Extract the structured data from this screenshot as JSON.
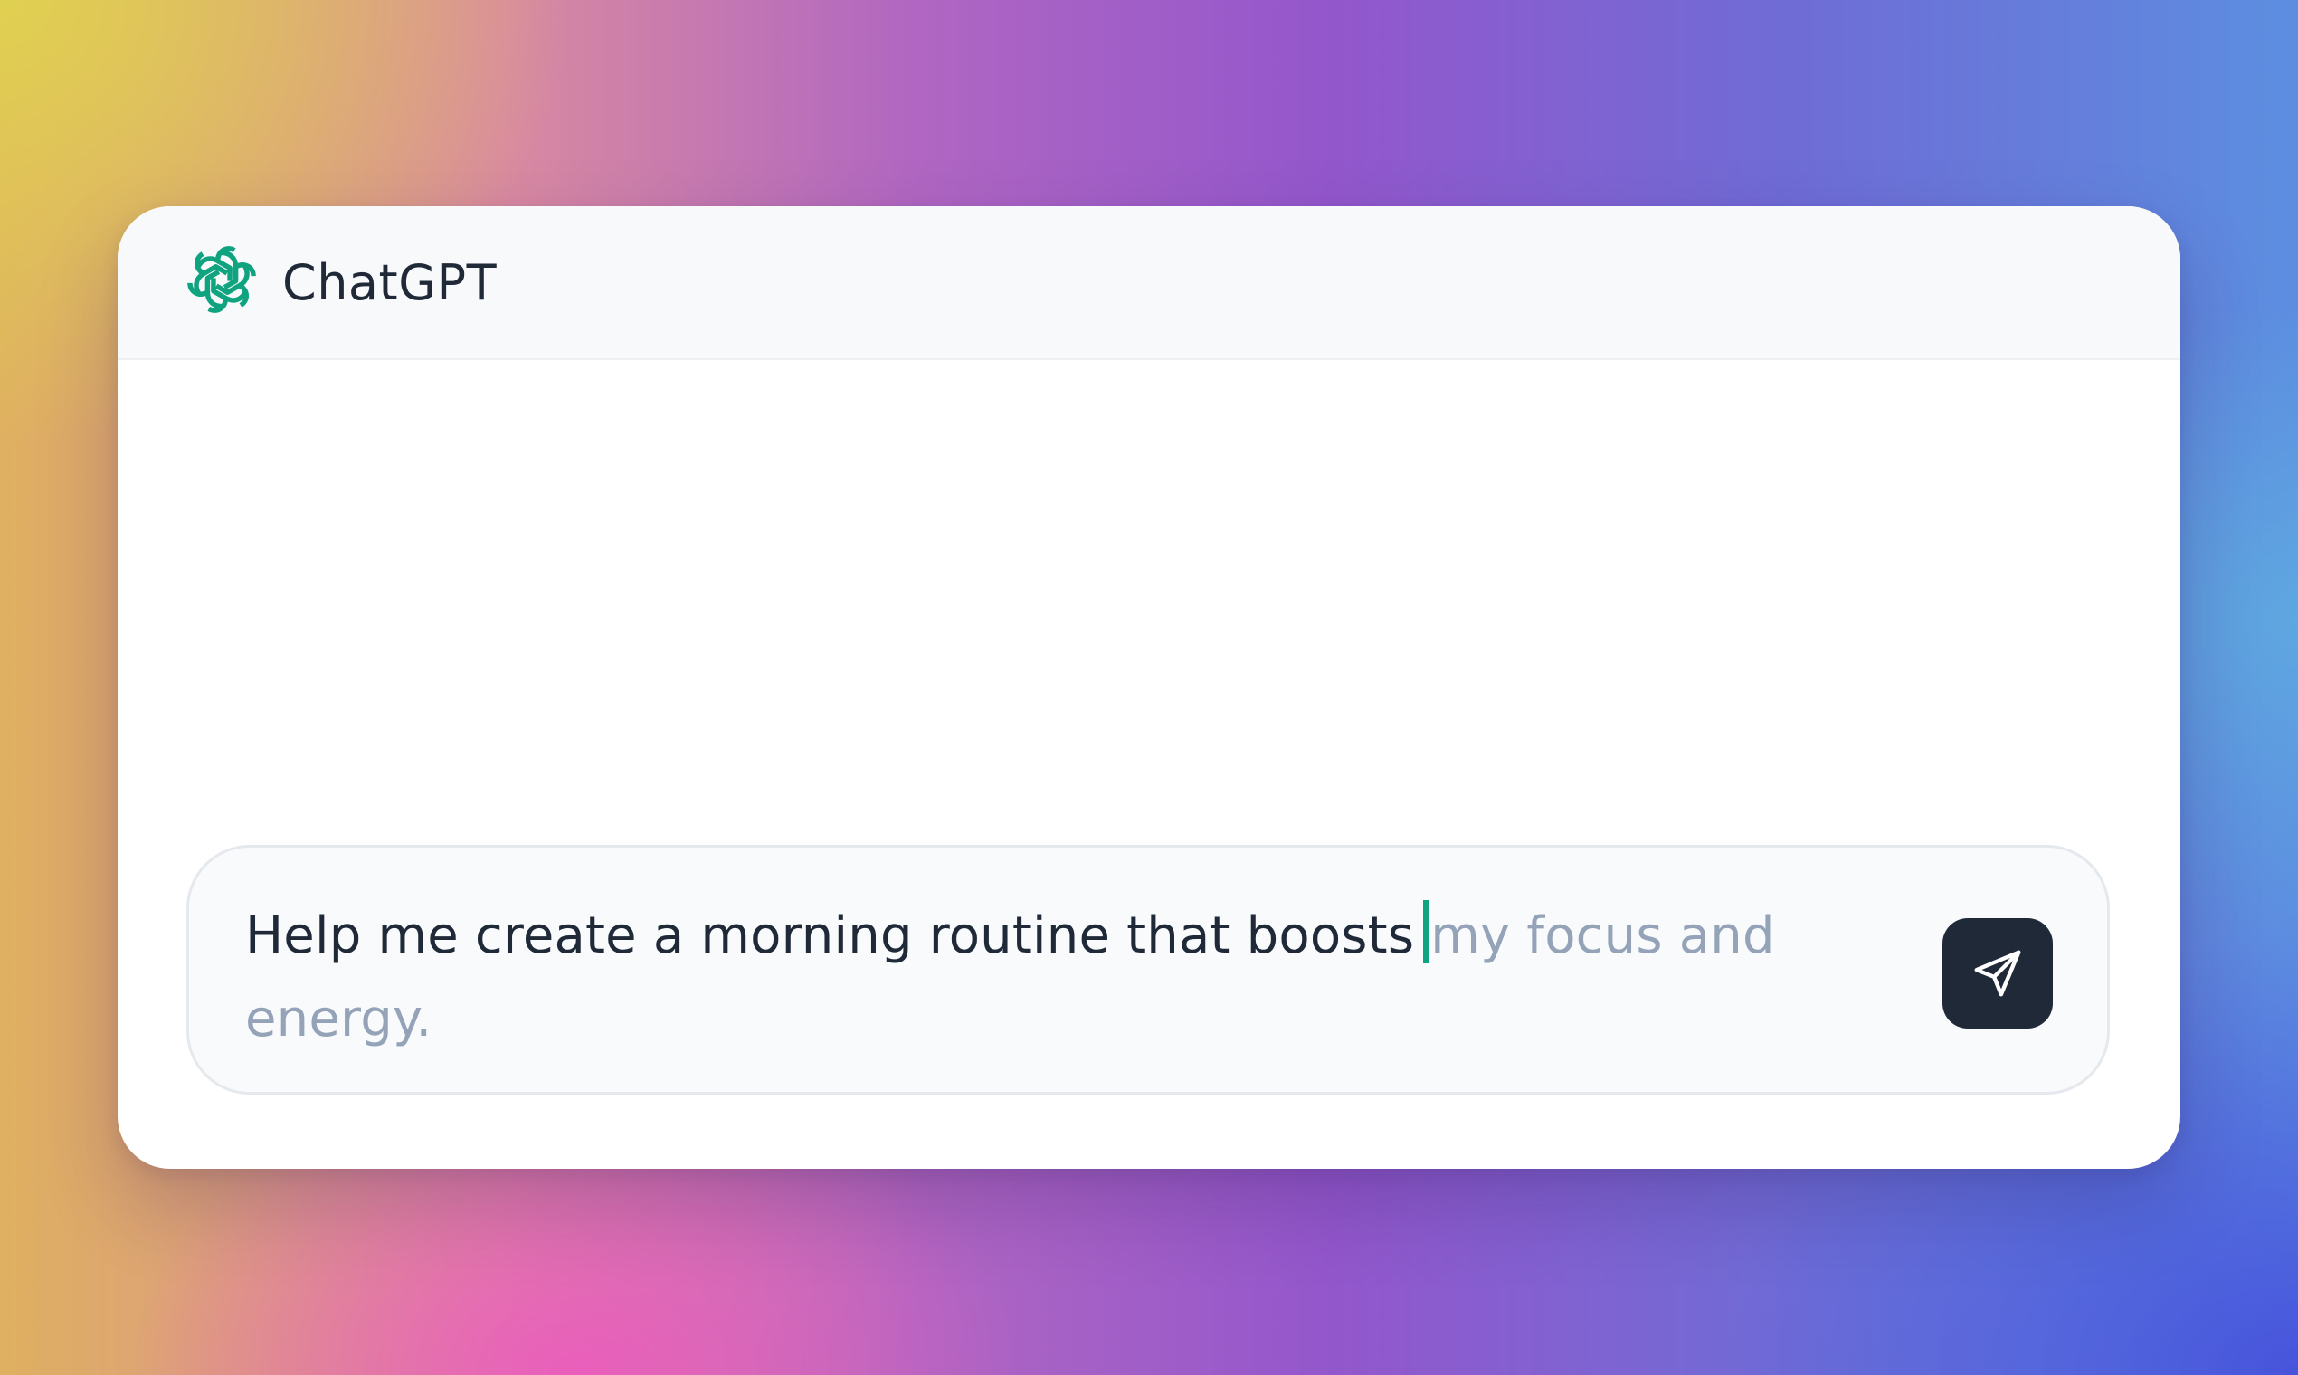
{
  "app": {
    "title": "ChatGPT",
    "logo_icon": "openai-logo-icon",
    "brand_color": "#10a37f"
  },
  "composer": {
    "typed_text": "Help me create a morning routine that boosts",
    "suggestion_text": "my focus and energy.",
    "send_icon": "send-icon",
    "caret_color": "#10a37f",
    "text_color": "#1f2937",
    "suggestion_color": "#94a3b8",
    "send_button_color": "#1f2937"
  }
}
